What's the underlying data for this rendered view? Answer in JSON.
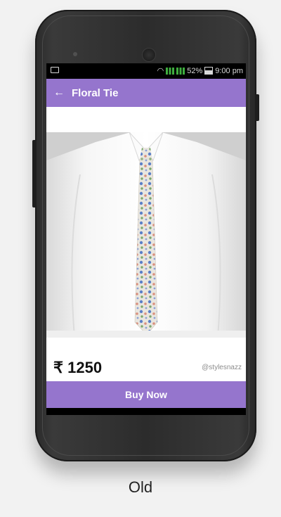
{
  "status_bar": {
    "battery": "52%",
    "time": "9:00 pm"
  },
  "app_bar": {
    "back_icon": "arrow-left-icon",
    "title": "Floral Tie"
  },
  "product": {
    "image": "white shirt with floral tie",
    "price": "₹ 1250",
    "seller": "@stylesnazz"
  },
  "buy_button": {
    "label": "Buy Now"
  },
  "colors": {
    "accent": "#9575cd"
  },
  "caption": "Old"
}
